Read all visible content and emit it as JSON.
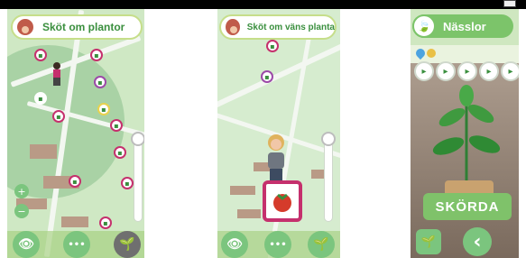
{
  "phones": [
    {
      "title": "Sköt om plantor"
    },
    {
      "title": "Sköt om väns planta"
    },
    {
      "title": "Nässlor",
      "harvest_label": "SKÖRDA"
    }
  ],
  "icons": {
    "eye": "👁",
    "more": "•••",
    "sprout": "🌱",
    "leaf": "🍃",
    "zoom_in": "+",
    "zoom_out": "−",
    "back": "‹"
  },
  "colors": {
    "brand_green": "#3a8f3e",
    "pin_magenta": "#c5306d",
    "light_green": "#7cc46a"
  }
}
